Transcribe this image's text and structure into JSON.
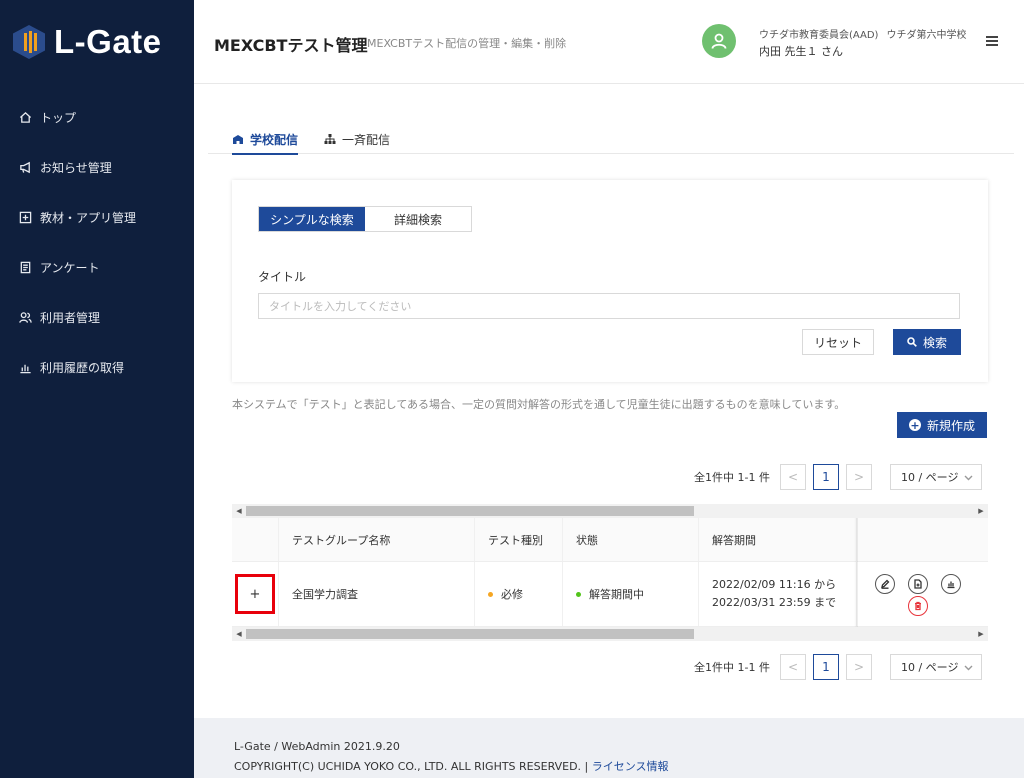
{
  "app": {
    "logo_text": "L-Gate"
  },
  "sidebar": {
    "items": [
      {
        "label": "トップ",
        "icon": "home-icon"
      },
      {
        "label": "お知らせ管理",
        "icon": "megaphone-icon"
      },
      {
        "label": "教材・アプリ管理",
        "icon": "plus-square-icon"
      },
      {
        "label": "アンケート",
        "icon": "survey-icon"
      },
      {
        "label": "利用者管理",
        "icon": "users-icon"
      },
      {
        "label": "利用履歴の取得",
        "icon": "bar-chart-icon"
      }
    ]
  },
  "header": {
    "title": "MEXCBTテスト管理",
    "subtitle": "MEXCBTテスト配信の管理・編集・削除",
    "org": "ウチダ市教育委員会(AAD)",
    "school": "ウチダ第六中学校",
    "user": "内田 先生１ さん"
  },
  "tabs": [
    {
      "label": "学校配信",
      "active": true
    },
    {
      "label": "一斉配信",
      "active": false
    }
  ],
  "search": {
    "simple_label": "シンプルな検索",
    "detail_label": "詳細検索",
    "title_label": "タイトル",
    "title_placeholder": "タイトルを入力してください",
    "title_value": "",
    "reset_label": "リセット",
    "search_label": "検索"
  },
  "notice": "本システムで「テスト」と表記してある場合、一定の質問対解答の形式を通して児童生徒に出題するものを意味しています。",
  "new_button": "新規作成",
  "pagination": {
    "total": "全1件中 1-1 件",
    "prev": "<",
    "current": "1",
    "next": ">",
    "page_size": "10 / ページ"
  },
  "table": {
    "headers": [
      "テストグループ名称",
      "テスト種別",
      "状態",
      "解答期間"
    ],
    "rows": [
      {
        "expand": "+",
        "name": "全国学力調査",
        "type": "必修",
        "status": "解答期間中",
        "period_start": "2022/02/09 11:16 から",
        "period_end": "2022/03/31 23:59 まで"
      }
    ]
  },
  "footer": {
    "version": "L-Gate / WebAdmin 2021.9.20",
    "copyright": "COPYRIGHT(C) UCHIDA YOKO CO., LTD. ALL RIGHTS RESERVED. |",
    "license": "ライセンス情報"
  },
  "colors": {
    "sidebar_bg": "#0f1f3d",
    "accent": "#1e4a9a",
    "avatar": "#6fc06f",
    "required_dot": "#f5a623",
    "status_dot": "#52c41a",
    "highlight": "#e8000b"
  }
}
